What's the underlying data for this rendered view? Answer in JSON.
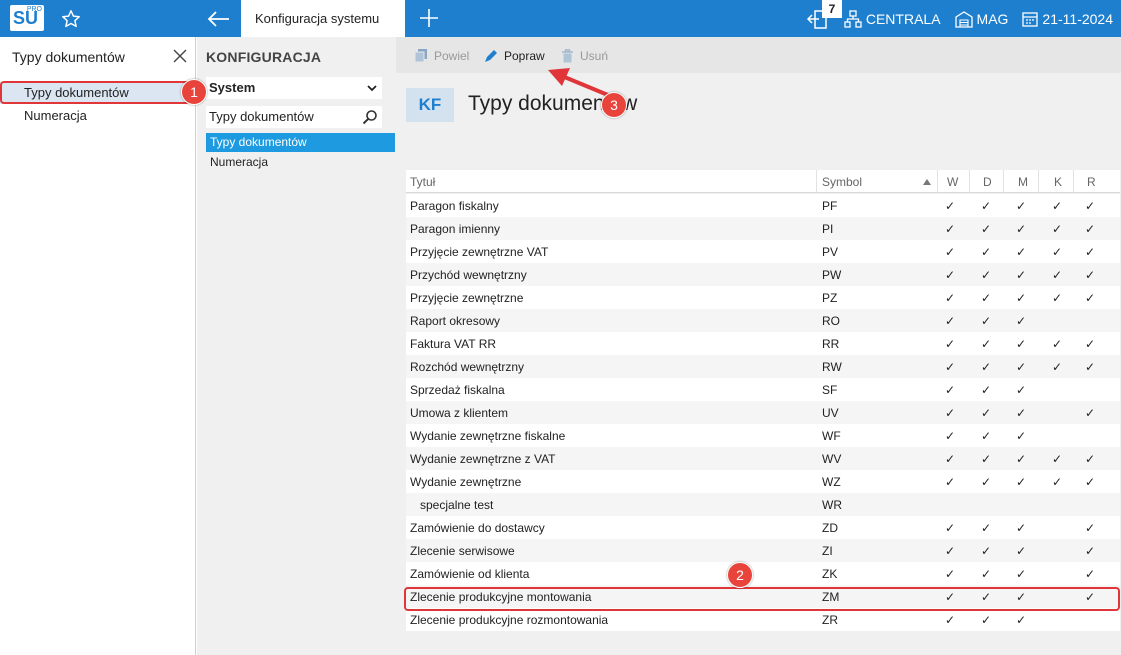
{
  "topbar": {
    "logo": "SU",
    "logo_sup": "PRO",
    "active_tab": "Konfiguracja systemu",
    "badge_count": "7",
    "branch": "CENTRALA",
    "warehouse": "MAG",
    "date": "21-11-2024"
  },
  "left": {
    "search_value": "Typy dokumentów",
    "items": [
      "Typy dokumentów",
      "Numeracja"
    ]
  },
  "mid": {
    "title": "KONFIGURACJA",
    "select_value": "System",
    "search_value": "Typy dokumentów",
    "items": [
      "Typy dokumentów",
      "Numeracja"
    ]
  },
  "toolbar": {
    "copy": "Powiel",
    "edit": "Popraw",
    "delete": "Usuń"
  },
  "header": {
    "badge": "KF",
    "title": "Typy dokumentów"
  },
  "grid": {
    "columns": [
      "Tytuł",
      "Symbol",
      "W",
      "D",
      "M",
      "K",
      "R"
    ],
    "check_glyph": "✓",
    "rows": [
      {
        "title": "Paragon fiskalny",
        "symbol": "PF",
        "W": true,
        "D": true,
        "M": true,
        "K": true,
        "R": true
      },
      {
        "title": "Paragon imienny",
        "symbol": "PI",
        "W": true,
        "D": true,
        "M": true,
        "K": true,
        "R": true
      },
      {
        "title": "Przyjęcie zewnętrzne VAT",
        "symbol": "PV",
        "W": true,
        "D": true,
        "M": true,
        "K": true,
        "R": true
      },
      {
        "title": "Przychód wewnętrzny",
        "symbol": "PW",
        "W": true,
        "D": true,
        "M": true,
        "K": true,
        "R": true
      },
      {
        "title": "Przyjęcie zewnętrzne",
        "symbol": "PZ",
        "W": true,
        "D": true,
        "M": true,
        "K": true,
        "R": true
      },
      {
        "title": "Raport okresowy",
        "symbol": "RO",
        "W": true,
        "D": true,
        "M": true,
        "K": false,
        "R": false
      },
      {
        "title": "Faktura VAT RR",
        "symbol": "RR",
        "W": true,
        "D": true,
        "M": true,
        "K": true,
        "R": true
      },
      {
        "title": "Rozchód wewnętrzny",
        "symbol": "RW",
        "W": true,
        "D": true,
        "M": true,
        "K": true,
        "R": true
      },
      {
        "title": "Sprzedaż fiskalna",
        "symbol": "SF",
        "W": true,
        "D": true,
        "M": true,
        "K": false,
        "R": false
      },
      {
        "title": "Umowa z klientem",
        "symbol": "UV",
        "W": true,
        "D": true,
        "M": true,
        "K": false,
        "R": true
      },
      {
        "title": "Wydanie zewnętrzne fiskalne",
        "symbol": "WF",
        "W": true,
        "D": true,
        "M": true,
        "K": false,
        "R": false
      },
      {
        "title": "Wydanie zewnętrzne z VAT",
        "symbol": "WV",
        "W": true,
        "D": true,
        "M": true,
        "K": true,
        "R": true
      },
      {
        "title": "Wydanie zewnętrzne",
        "symbol": "WZ",
        "W": true,
        "D": true,
        "M": true,
        "K": true,
        "R": true
      },
      {
        "title": "specjalne test",
        "symbol": "WR",
        "W": false,
        "D": false,
        "M": false,
        "K": false,
        "R": false
      },
      {
        "title": "Zamówienie do dostawcy",
        "symbol": "ZD",
        "W": true,
        "D": true,
        "M": true,
        "K": false,
        "R": true
      },
      {
        "title": "Zlecenie serwisowe",
        "symbol": "ZI",
        "W": true,
        "D": true,
        "M": true,
        "K": false,
        "R": true
      },
      {
        "title": "Zamówienie od klienta",
        "symbol": "ZK",
        "W": true,
        "D": true,
        "M": true,
        "K": false,
        "R": true
      },
      {
        "title": "Zlecenie produkcyjne montowania",
        "symbol": "ZM",
        "W": true,
        "D": true,
        "M": true,
        "K": false,
        "R": true
      },
      {
        "title": "Zlecenie produkcyjne rozmontowania",
        "symbol": "ZR",
        "W": true,
        "D": true,
        "M": true,
        "K": false,
        "R": false
      }
    ]
  },
  "annotations": [
    "1",
    "2",
    "3"
  ],
  "colors": {
    "accent": "#1e7fcf",
    "selection": "#1e9ae0",
    "marker": "#e0363a"
  }
}
